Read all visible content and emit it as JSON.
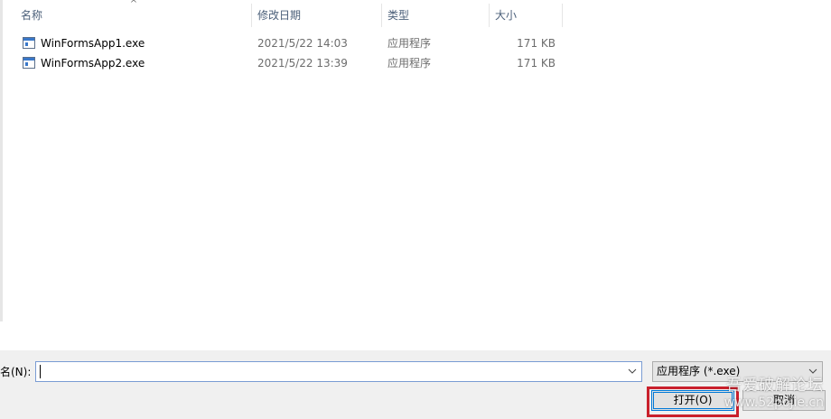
{
  "columns": {
    "name": "名称",
    "modified": "修改日期",
    "type": "类型",
    "size": "大小",
    "sort_arrow": "^"
  },
  "files": [
    {
      "name": "WinFormsApp1.exe",
      "modified": "2021/5/22 14:03",
      "type": "应用程序",
      "size": "171 KB",
      "icon": "exe-icon"
    },
    {
      "name": "WinFormsApp2.exe",
      "modified": "2021/5/22 13:39",
      "type": "应用程序",
      "size": "171 KB",
      "icon": "exe-icon"
    }
  ],
  "bottom": {
    "filename_label": "名(N):",
    "filename_value": "",
    "filename_dropdown_icon": "chevron-down-icon",
    "filter_value": "应用程序 (*.exe)",
    "filter_dropdown_icon": "chevron-down-icon",
    "open_label": "打开(O)",
    "cancel_label": "取消"
  },
  "watermark": {
    "title": "吾爱破解论坛",
    "url": "www.52pojie.cn"
  },
  "colors": {
    "highlight_border": "#c9202c",
    "focus_blue": "#0078d7",
    "header_text": "#4c607a"
  }
}
